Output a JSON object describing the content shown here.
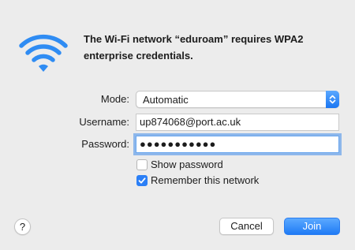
{
  "message": "The Wi-Fi network “eduroam” requires WPA2 enterprise credentials.",
  "colors": {
    "accent": "#1f7bf5",
    "wifi": "#2f8cf3"
  },
  "icons": {
    "wifi": "wifi-icon",
    "help": "help-icon"
  },
  "form": {
    "mode_label": "Mode:",
    "mode_value": "Automatic",
    "username_label": "Username:",
    "username_value": "up874068@port.ac.uk",
    "password_label": "Password:",
    "password_mask": "●●●●●●●●●●●",
    "show_password_label": "Show password",
    "show_password_checked": false,
    "remember_label": "Remember this network",
    "remember_checked": true
  },
  "buttons": {
    "help_label": "?",
    "cancel_label": "Cancel",
    "join_label": "Join"
  }
}
